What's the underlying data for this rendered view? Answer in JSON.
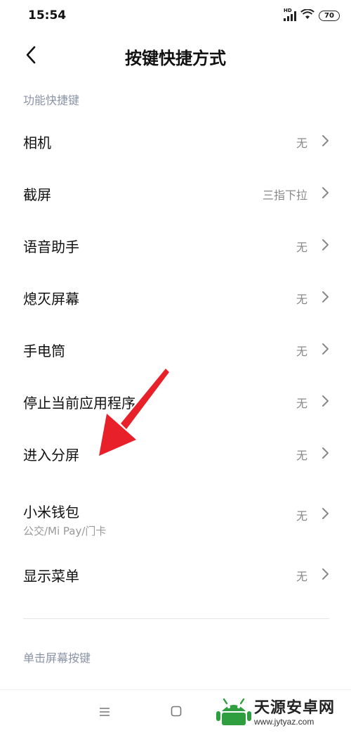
{
  "status_bar": {
    "time": "15:54",
    "network_label": "HD",
    "battery": "70"
  },
  "header": {
    "title": "按键快捷方式"
  },
  "sections": {
    "function_shortcuts_title": "功能快捷键",
    "single_tap_title": "单击屏幕按键"
  },
  "rows": [
    {
      "label": "相机",
      "value": "无"
    },
    {
      "label": "截屏",
      "value": "三指下拉"
    },
    {
      "label": "语音助手",
      "value": "无"
    },
    {
      "label": "熄灭屏幕",
      "value": "无"
    },
    {
      "label": "手电筒",
      "value": "无"
    },
    {
      "label": "停止当前应用程序",
      "value": "无"
    },
    {
      "label": "进入分屏",
      "value": "无"
    },
    {
      "label": "小米钱包",
      "sublabel": "公交/Mi Pay/门卡",
      "value": "无"
    },
    {
      "label": "显示菜单",
      "value": "无"
    }
  ],
  "watermark": {
    "name": "天源安卓网",
    "url": "www.jytyaz.com"
  },
  "colors": {
    "section_title": "#8a93a6",
    "annotation_arrow": "#e8202a",
    "watermark_logo": "#2f9e3f"
  }
}
